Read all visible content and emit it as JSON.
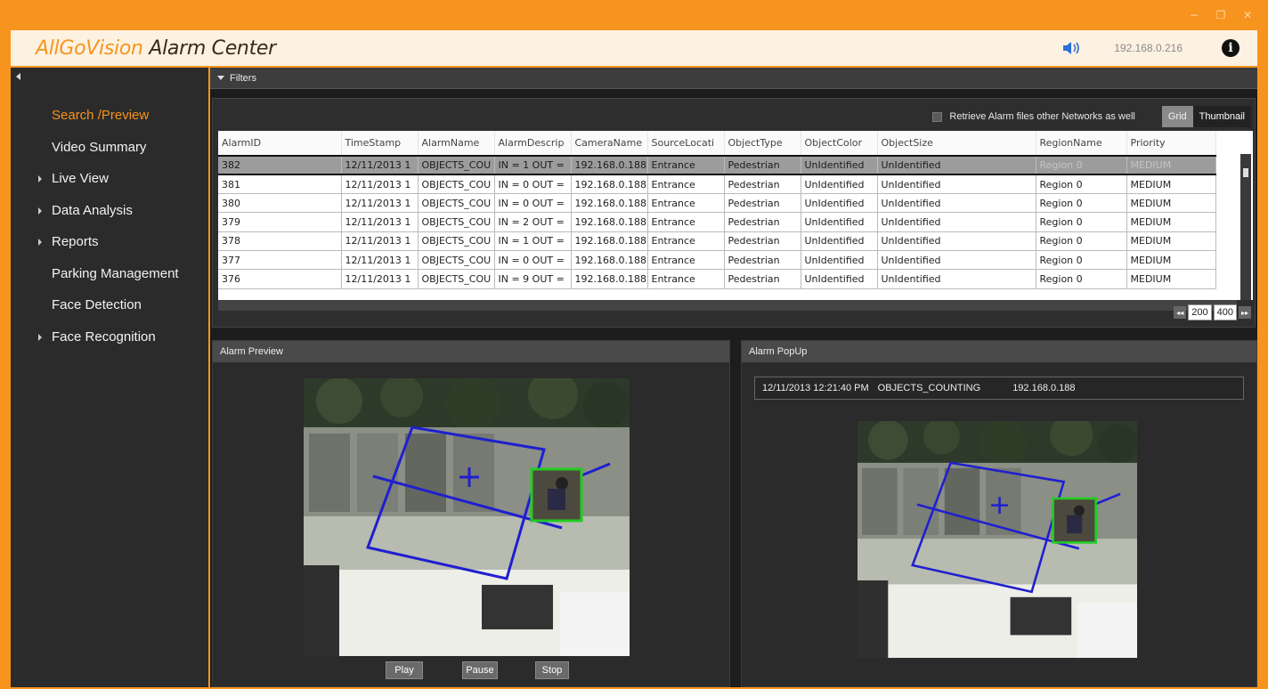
{
  "window": {
    "minimize_glyph": "−",
    "restore_glyph": "❐",
    "close_glyph": "✕"
  },
  "header": {
    "brand": "AllGoVision",
    "product": "Alarm Center",
    "ip": "192.168.0.216",
    "speaker_icon": "speaker-icon",
    "info_icon": "info-icon",
    "info_glyph": "i"
  },
  "sidebar": {
    "items": [
      {
        "label": "Search /Preview",
        "active": true,
        "expandable": false
      },
      {
        "label": "Video Summary",
        "active": false,
        "expandable": false
      },
      {
        "label": "Live View",
        "active": false,
        "expandable": true
      },
      {
        "label": "Data Analysis",
        "active": false,
        "expandable": true
      },
      {
        "label": "Reports",
        "active": false,
        "expandable": true
      },
      {
        "label": "Parking Management",
        "active": false,
        "expandable": false
      },
      {
        "label": "Face Detection",
        "active": false,
        "expandable": false
      },
      {
        "label": "Face Recognition",
        "active": false,
        "expandable": true
      }
    ]
  },
  "filters": {
    "label": "Filters"
  },
  "grid": {
    "retrieve_label": "Retrieve Alarm files other Networks as well",
    "view_grid": "Grid",
    "view_thumbnail": "Thumbnail",
    "columns": [
      "AlarmID",
      "TimeStamp",
      "AlarmName",
      "AlarmDescrip",
      "CameraName",
      "SourceLocati",
      "ObjectType",
      "ObjectColor",
      "ObjectSize",
      "RegionName",
      "Priority"
    ],
    "rows": [
      [
        "382",
        "12/11/2013 1",
        "OBJECTS_COU",
        "IN = 1 OUT =",
        "192.168.0.188",
        "Entrance",
        "Pedestrian",
        "UnIdentified",
        "UnIdentified",
        "Region 0",
        "MEDIUM"
      ],
      [
        "381",
        "12/11/2013 1",
        "OBJECTS_COU",
        "IN = 0 OUT =",
        "192.168.0.188",
        "Entrance",
        "Pedestrian",
        "UnIdentified",
        "UnIdentified",
        "Region 0",
        "MEDIUM"
      ],
      [
        "380",
        "12/11/2013 1",
        "OBJECTS_COU",
        "IN = 0 OUT =",
        "192.168.0.188",
        "Entrance",
        "Pedestrian",
        "UnIdentified",
        "UnIdentified",
        "Region 0",
        "MEDIUM"
      ],
      [
        "379",
        "12/11/2013 1",
        "OBJECTS_COU",
        "IN = 2 OUT =",
        "192.168.0.188",
        "Entrance",
        "Pedestrian",
        "UnIdentified",
        "UnIdentified",
        "Region 0",
        "MEDIUM"
      ],
      [
        "378",
        "12/11/2013 1",
        "OBJECTS_COU",
        "IN = 1 OUT =",
        "192.168.0.188",
        "Entrance",
        "Pedestrian",
        "UnIdentified",
        "UnIdentified",
        "Region 0",
        "MEDIUM"
      ],
      [
        "377",
        "12/11/2013 1",
        "OBJECTS_COU",
        "IN = 0 OUT =",
        "192.168.0.188",
        "Entrance",
        "Pedestrian",
        "UnIdentified",
        "UnIdentified",
        "Region 0",
        "MEDIUM"
      ],
      [
        "376",
        "12/11/2013 1",
        "OBJECTS_COU",
        "IN = 9 OUT =",
        "192.168.0.188",
        "Entrance",
        "Pedestrian",
        "UnIdentified",
        "UnIdentified",
        "Region 0",
        "MEDIUM"
      ]
    ],
    "pager": {
      "prev": "◂◂",
      "pages": [
        "200",
        "400"
      ],
      "next": "▸▸"
    }
  },
  "preview": {
    "title": "Alarm Preview",
    "play": "Play",
    "pause": "Pause",
    "stop": "Stop"
  },
  "popup": {
    "title": "Alarm PopUp",
    "timestamp": "12/11/2013 12:21:40 PM",
    "alarm": "OBJECTS_COUNTING",
    "camera": "192.168.0.188"
  },
  "colors": {
    "accent": "#f7941d",
    "zone_line": "#1f1fd0",
    "detection_box": "#22cc22"
  }
}
